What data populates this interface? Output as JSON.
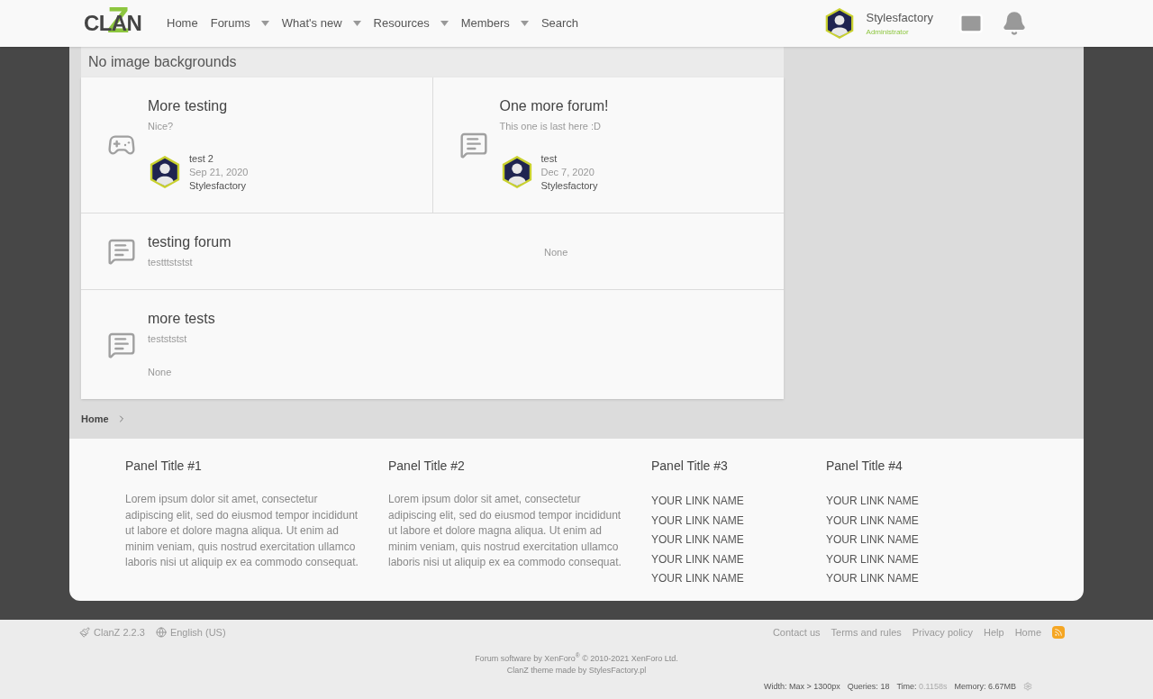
{
  "header": {
    "logo": {
      "word": "CLAN",
      "mark": "Z"
    },
    "nav": [
      {
        "label": "Home",
        "dropdown": false
      },
      {
        "label": "Forums",
        "dropdown": true
      },
      {
        "label": "What's new",
        "dropdown": true
      },
      {
        "label": "Resources",
        "dropdown": true
      },
      {
        "label": "Members",
        "dropdown": true
      },
      {
        "label": "Search",
        "dropdown": false
      }
    ],
    "user": {
      "name": "Stylesfactory",
      "role": "Administrator"
    }
  },
  "section": {
    "title": "No image backgrounds",
    "rows": [
      {
        "nodes": [
          {
            "kind": "game",
            "title": "More testing",
            "description": "Nice?",
            "latest": {
              "kind": "post",
              "thread": "test 2",
              "date": "Sep 21, 2020",
              "user": "Stylesfactory"
            }
          },
          {
            "kind": "discussion",
            "title": "One more forum!",
            "description": "This one is last here :D",
            "latest": {
              "kind": "post",
              "thread": "test",
              "date": "Dec 7, 2020",
              "user": "Stylesfactory"
            }
          }
        ]
      },
      {
        "nodes": [
          {
            "kind": "discussion",
            "title": "testing forum",
            "description": "testttststst",
            "latest": {
              "kind": "none-inline",
              "text": "None"
            }
          }
        ]
      },
      {
        "nodes": [
          {
            "kind": "discussion",
            "title": "more tests",
            "description": "testststst",
            "latest": {
              "kind": "none-stacked",
              "text": "None"
            }
          }
        ]
      }
    ]
  },
  "breadcrumb": [
    "Home"
  ],
  "panels": [
    {
      "title": "Panel Title #1",
      "kind": "text",
      "text": "Lorem ipsum dolor sit amet, consectetur adipiscing elit, sed do eiusmod tempor incididunt ut labore et dolore magna aliqua. Ut enim ad minim veniam, quis nostrud exercitation ullamco laboris nisi ut aliquip ex ea commodo consequat."
    },
    {
      "title": "Panel Title #2",
      "kind": "text",
      "text": "Lorem ipsum dolor sit amet, consectetur adipiscing elit, sed do eiusmod tempor incididunt ut labore et dolore magna aliqua. Ut enim ad minim veniam, quis nostrud exercitation ullamco laboris nisi ut aliquip ex ea commodo consequat."
    },
    {
      "title": "Panel Title #3",
      "kind": "links",
      "links": [
        "YOUR LINK NAME",
        "YOUR LINK NAME",
        "YOUR LINK NAME",
        "YOUR LINK NAME",
        "YOUR LINK NAME"
      ]
    },
    {
      "title": "Panel Title #4",
      "kind": "links",
      "links": [
        "YOUR LINK NAME",
        "YOUR LINK NAME",
        "YOUR LINK NAME",
        "YOUR LINK NAME",
        "YOUR LINK NAME"
      ]
    }
  ],
  "footer": {
    "left": [
      {
        "kind": "style",
        "label": "ClanZ 2.2.3"
      },
      {
        "kind": "language",
        "label": "English (US)"
      }
    ],
    "links": [
      "Contact us",
      "Terms and rules",
      "Privacy policy",
      "Help",
      "Home"
    ],
    "copyright": [
      "Forum software by XenForo$^{®}$ © 2010-2021 XenForo Ltd.",
      "ClanZ theme made by StylesFactory.pl"
    ],
    "debug": [
      {
        "label": "Width:",
        "value": "Max > 1300px",
        "highlight": false
      },
      {
        "label": "Queries:",
        "value": "18",
        "highlight": false
      },
      {
        "label": "Time:",
        "value": "0.1158s",
        "highlight": true
      },
      {
        "label": "Memory:",
        "value": "6.67MB",
        "highlight": false
      }
    ]
  }
}
